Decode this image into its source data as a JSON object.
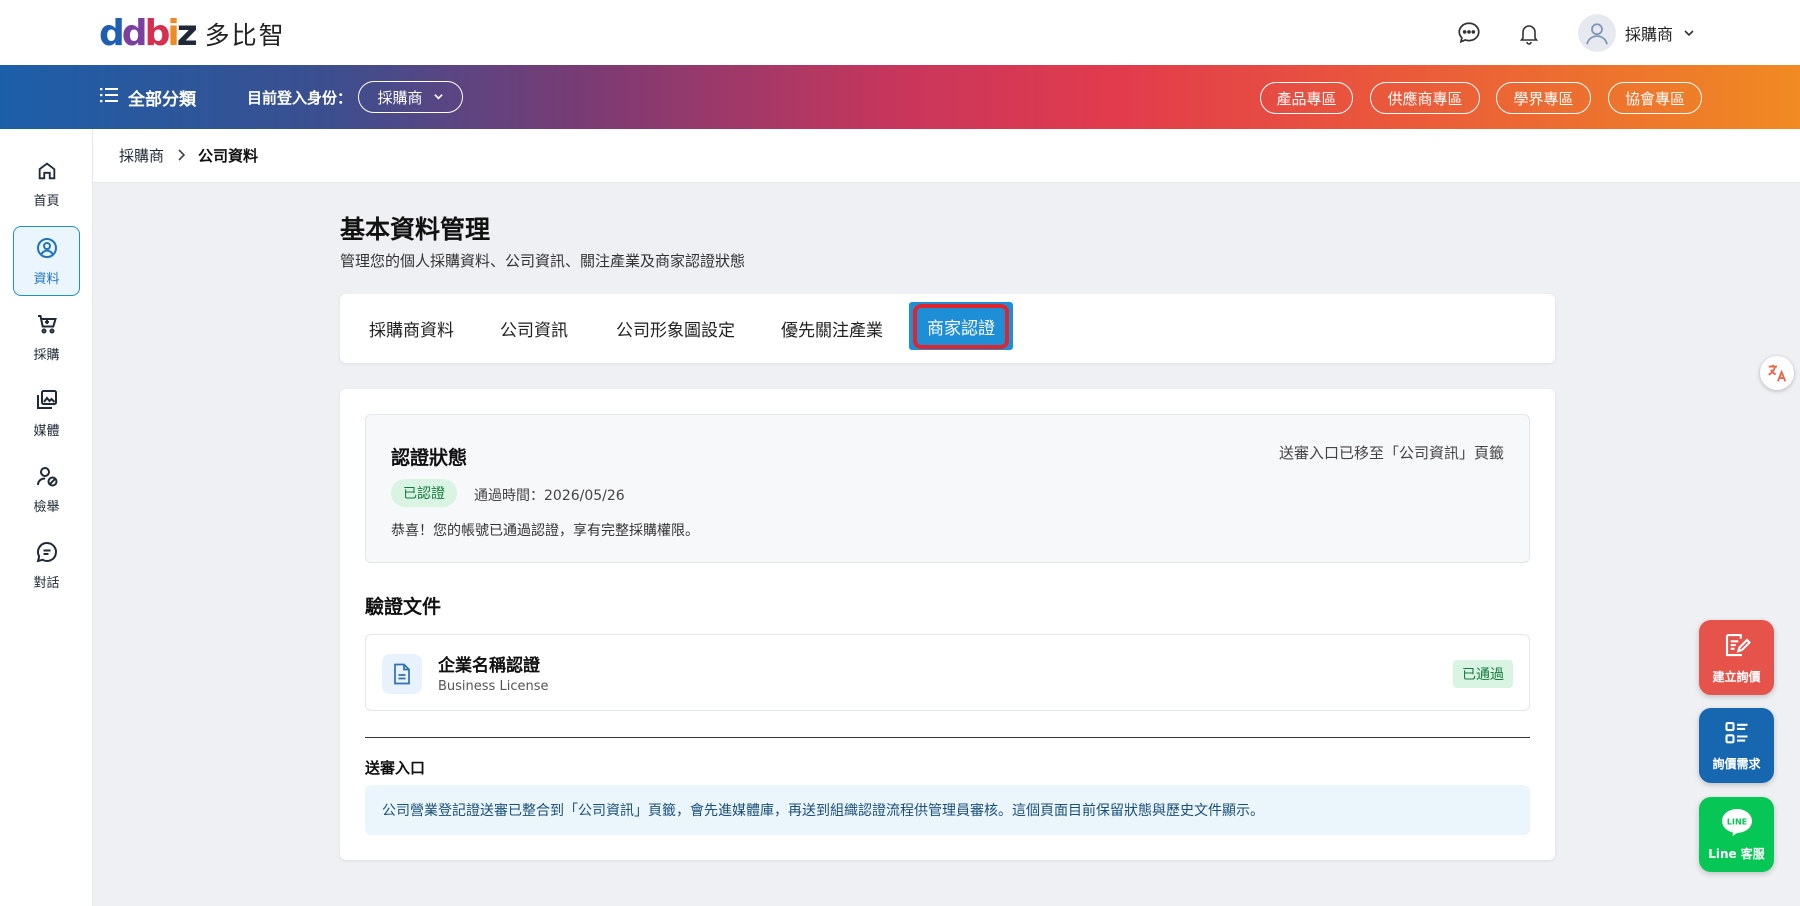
{
  "header": {
    "brand_mark": {
      "d1": "d",
      "d2": "d",
      "b": "b",
      "i": "i",
      "z": "z"
    },
    "brand_name": "多比智",
    "user_name": "採購商",
    "icons": [
      "chat-icon",
      "bell-icon",
      "user-avatar-icon",
      "chevron-down-icon"
    ]
  },
  "navbar": {
    "all_categories": "全部分類",
    "login_as_label": "目前登入身份：",
    "role": "採購商",
    "zones": [
      "產品專區",
      "供應商專區",
      "學界專區",
      "協會專區"
    ]
  },
  "sidebar": {
    "items": [
      {
        "label": "首頁",
        "icon": "home-icon"
      },
      {
        "label": "資料",
        "icon": "user-circle-icon",
        "active": true
      },
      {
        "label": "採購",
        "icon": "cart-icon"
      },
      {
        "label": "媒體",
        "icon": "media-icon"
      },
      {
        "label": "檢舉",
        "icon": "report-user-icon"
      },
      {
        "label": "對話",
        "icon": "message-icon"
      }
    ]
  },
  "breadcrumb": {
    "root": "採購商",
    "current": "公司資料"
  },
  "page": {
    "title": "基本資料管理",
    "subtitle": "管理您的個人採購資料、公司資訊、關注產業及商家認證狀態"
  },
  "tabs": [
    {
      "label": "採購商資料"
    },
    {
      "label": "公司資訊"
    },
    {
      "label": "公司形象圖設定"
    },
    {
      "label": "優先關注產業"
    },
    {
      "label": "商家認證",
      "active": true
    }
  ],
  "certification": {
    "title": "認證狀態",
    "note": "送審入口已移至「公司資訊」頁籤",
    "badge": "已認證",
    "pass_time": "通過時間：2026/05/26",
    "message": "恭喜！您的帳號已通過認證，享有完整採購權限。"
  },
  "documents": {
    "title": "驗證文件",
    "items": [
      {
        "name": "企業名稱認證",
        "name_en": "Business License",
        "status": "已通過"
      }
    ]
  },
  "submission": {
    "title": "送審入口",
    "info": "公司營業登記證送審已整合到「公司資訊」頁籤，會先進媒體庫，再送到組織認證流程供管理員審核。這個頁面目前保留狀態與歷史文件顯示。"
  },
  "fabs": [
    {
      "label": "建立詢價",
      "icon": "edit-note-icon",
      "color": "#e5534b"
    },
    {
      "label": "詢價需求",
      "icon": "list-icon",
      "color": "#1766b0"
    },
    {
      "label": "Line 客服",
      "icon": "line-icon",
      "icon_text": "LINE",
      "color": "#06c755"
    }
  ],
  "colors": {
    "accent": "#1e8fd6",
    "highlight": "#e0262d",
    "success": "#157a3d"
  }
}
